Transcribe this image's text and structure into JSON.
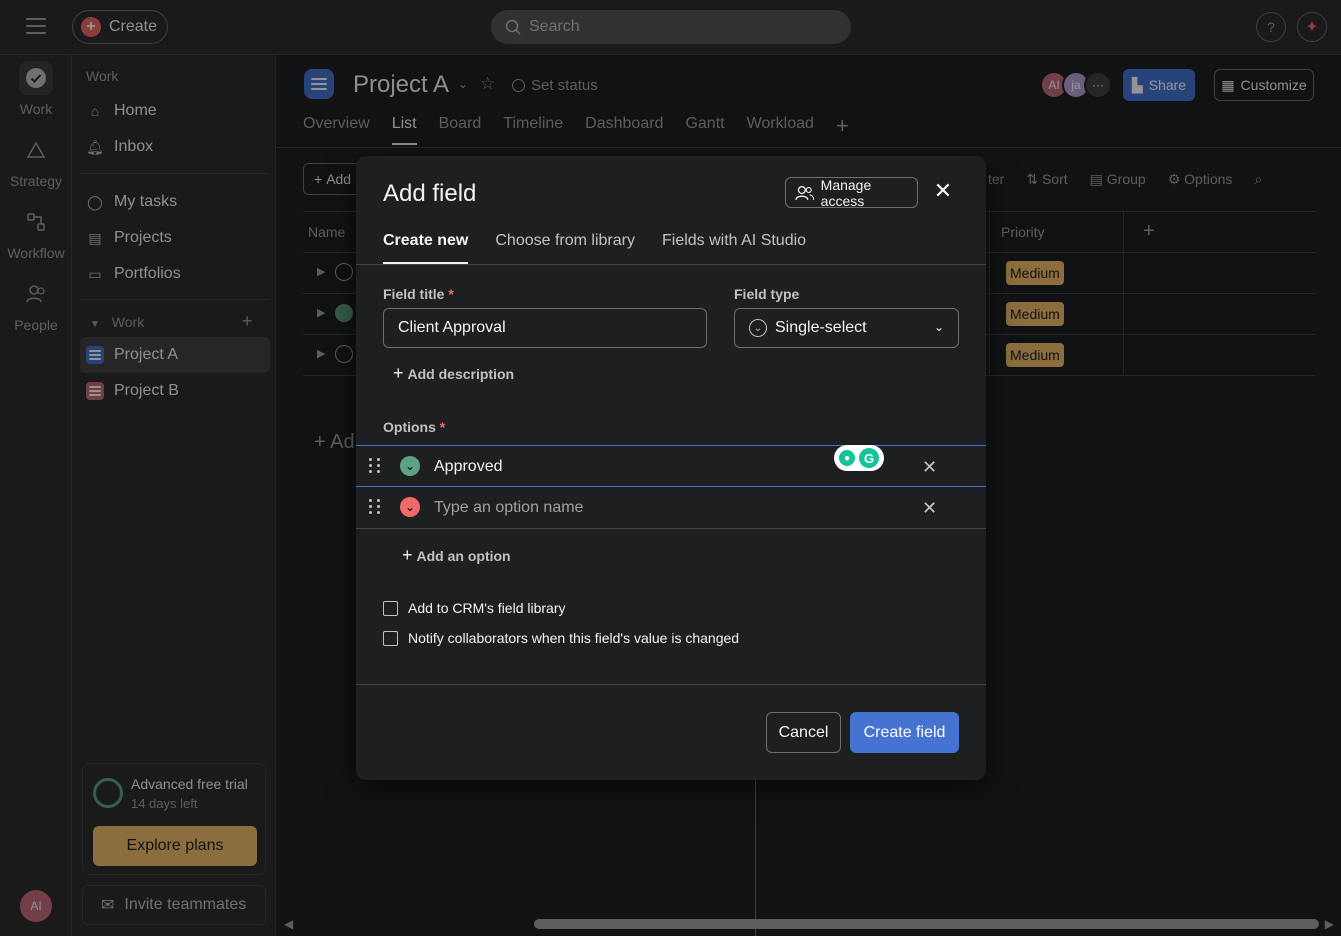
{
  "topbar": {
    "create_label": "Create",
    "search_placeholder": "Search",
    "help_label": "?",
    "ai_icon": "sparkle-icon"
  },
  "rail": {
    "items": [
      {
        "label": "Work",
        "icon": "check-circle-icon"
      },
      {
        "label": "Strategy",
        "icon": "triangle-icon"
      },
      {
        "label": "Workflow",
        "icon": "workflow-icon"
      },
      {
        "label": "People",
        "icon": "people-icon"
      }
    ],
    "avatar_initials": "AI"
  },
  "sidebar": {
    "work_label": "Work",
    "home_label": "Home",
    "inbox_label": "Inbox",
    "my_tasks_label": "My tasks",
    "projects_label": "Projects",
    "portfolios_label": "Portfolios",
    "work_section_label": "Work",
    "projects": [
      {
        "name": "Project A",
        "color": "#4573d2"
      },
      {
        "name": "Project B",
        "color": "#c46b7d"
      }
    ],
    "trial_title": "Advanced free trial",
    "trial_sub": "14 days left",
    "explore_label": "Explore plans",
    "invite_label": "Invite teammates"
  },
  "project": {
    "title": "Project A",
    "set_status_label": "Set status",
    "avatars": [
      {
        "initials": "AI",
        "color": "#c46b7d"
      },
      {
        "initials": "ja",
        "color": "#b8a0d6"
      },
      {
        "initials": "···",
        "color": "#424244"
      }
    ],
    "share_label": "Share",
    "customize_label": "Customize",
    "tabs": [
      "Overview",
      "List",
      "Board",
      "Timeline",
      "Dashboard",
      "Gantt",
      "Workload"
    ],
    "active_tab": "List",
    "add_label": "Add",
    "toolbar": [
      "ter",
      "Sort",
      "Group",
      "Options"
    ],
    "column_name": "Name",
    "column_priority": "Priority",
    "rows": [
      {
        "priority": "Medium",
        "done": false
      },
      {
        "priority": "Medium",
        "done": true
      },
      {
        "priority": "Medium",
        "done": false
      }
    ],
    "add_section_label": "+ Ad"
  },
  "modal": {
    "title": "Add field",
    "manage_access_label": "Manage access",
    "tabs": [
      "Create new",
      "Choose from library",
      "Fields with AI Studio"
    ],
    "active_tab": "Create new",
    "field_title_label": "Field title",
    "required_mark": "*",
    "field_title_value": "Client Approval",
    "field_type_label": "Field type",
    "field_type_value": "Single-select",
    "add_description_label": "Add description",
    "options_label": "Options",
    "options": [
      {
        "text": "Approved",
        "placeholder": "",
        "color": "#5da283",
        "focused": true
      },
      {
        "text": "",
        "placeholder": "Type an option name",
        "color": "#f06a6a",
        "focused": false
      }
    ],
    "add_option_label": "Add an option",
    "checkbox_crm_label": "Add to CRM's field library",
    "checkbox_notify_label": "Notify collaborators when this field's value is changed",
    "cancel_label": "Cancel",
    "create_label": "Create field"
  }
}
